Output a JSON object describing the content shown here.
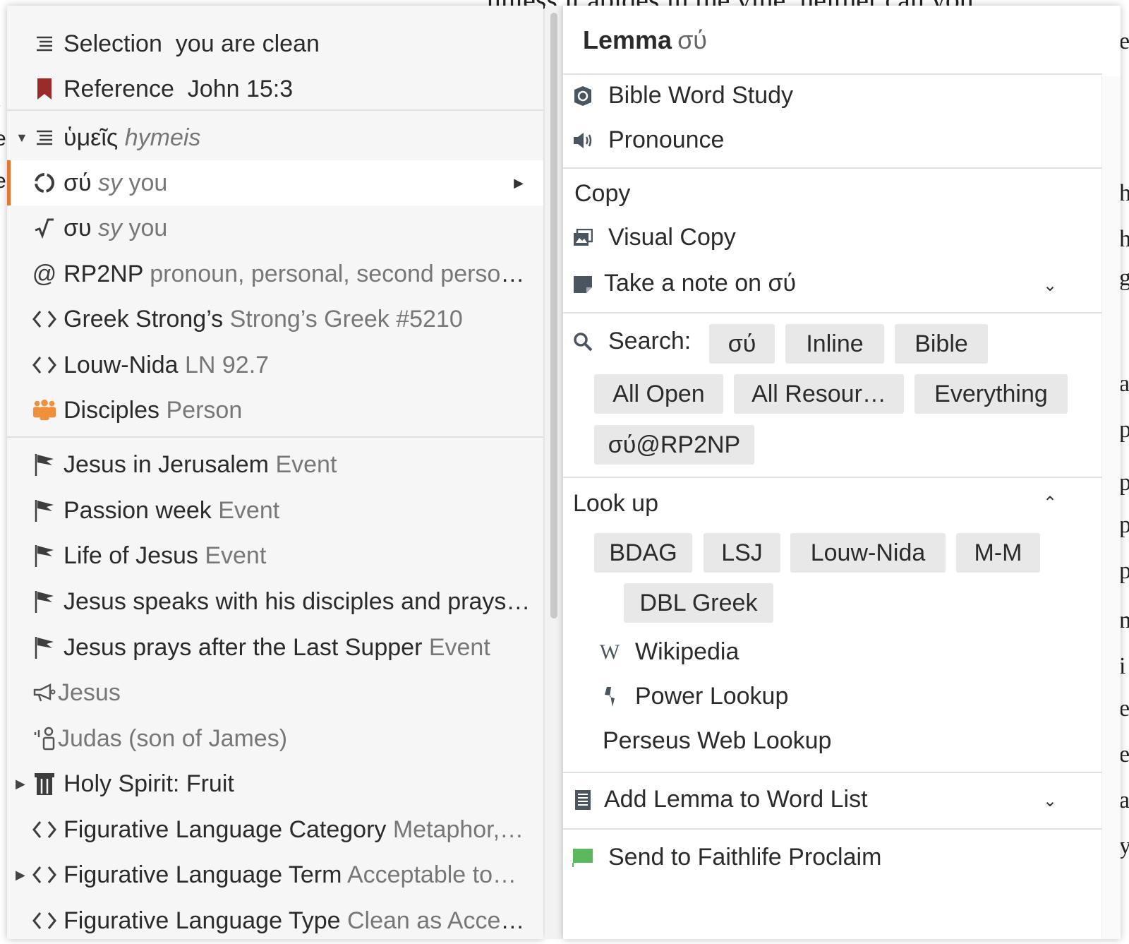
{
  "background": {
    "top_text": "unless it abides in the vine, neither can you,"
  },
  "left_menu": {
    "selection": {
      "label": "Selection",
      "value": "you are clean"
    },
    "reference": {
      "label": "Reference",
      "value": "John 15:3"
    },
    "hymeis": {
      "greek": "ὑμεῖς",
      "translit": "hymeis"
    },
    "lemma_row": {
      "greek": "σύ",
      "translit": "sy",
      "gloss": "you"
    },
    "root_row": {
      "greek": "συ",
      "translit": "sy",
      "gloss": "you"
    },
    "morph_row": {
      "code": "RP2NP",
      "desc": "pronoun, personal, second person…"
    },
    "strongs_row": {
      "label": "Greek Strong’s",
      "desc": "Strong’s Greek #5210"
    },
    "louw_row": {
      "label": "Louw-Nida",
      "desc": "LN 92.7"
    },
    "disciples_row": {
      "label": "Disciples",
      "desc": "Person"
    },
    "events": [
      {
        "label": "Jesus in Jerusalem",
        "desc": "Event"
      },
      {
        "label": "Passion week",
        "desc": "Event"
      },
      {
        "label": "Life of Jesus",
        "desc": "Event"
      },
      {
        "label": "Jesus speaks with his disciples and prays…",
        "desc": ""
      },
      {
        "label": "Jesus prays after the Last Supper",
        "desc": "Event"
      }
    ],
    "speaker_row": "Jesus",
    "addressee_row": "Judas (son of James)",
    "holy_spirit_row": "Holy Spirit: Fruit",
    "fig_cat_row": {
      "label": "Figurative Language Category",
      "desc": "Metaphor,…"
    },
    "fig_term_row": {
      "label": "Figurative Language Term",
      "desc": "Acceptable to…"
    },
    "fig_type_row": {
      "label": "Figurative Language Type",
      "desc": "Clean as Accept…"
    }
  },
  "right_menu": {
    "title_prefix": "Lemma",
    "title_greek": "σύ",
    "bible_word_study": "Bible Word Study",
    "pronounce": "Pronounce",
    "copy": "Copy",
    "visual_copy": "Visual Copy",
    "take_note": "Take a note on σύ",
    "search_label": "Search:",
    "search_chips": [
      "σύ",
      "Inline",
      "Bible",
      "All Open",
      "All Resour…",
      "Everything",
      "σύ@RP2NP"
    ],
    "lookup_label": "Look up",
    "lookup_chips": [
      "BDAG",
      "LSJ",
      "Louw-Nida",
      "M-M",
      "DBL Greek"
    ],
    "wikipedia": "Wikipedia",
    "power_lookup": "Power Lookup",
    "perseus": "Perseus Web Lookup",
    "add_word_list": "Add Lemma to Word List",
    "send_proclaim": "Send to Faithlife Proclaim"
  },
  "colors": {
    "accent": "#e8742d",
    "reference_bookmark": "#9b2a2a",
    "disciples_icon": "#f0903a",
    "proclaim_icon": "#5cb85c"
  }
}
